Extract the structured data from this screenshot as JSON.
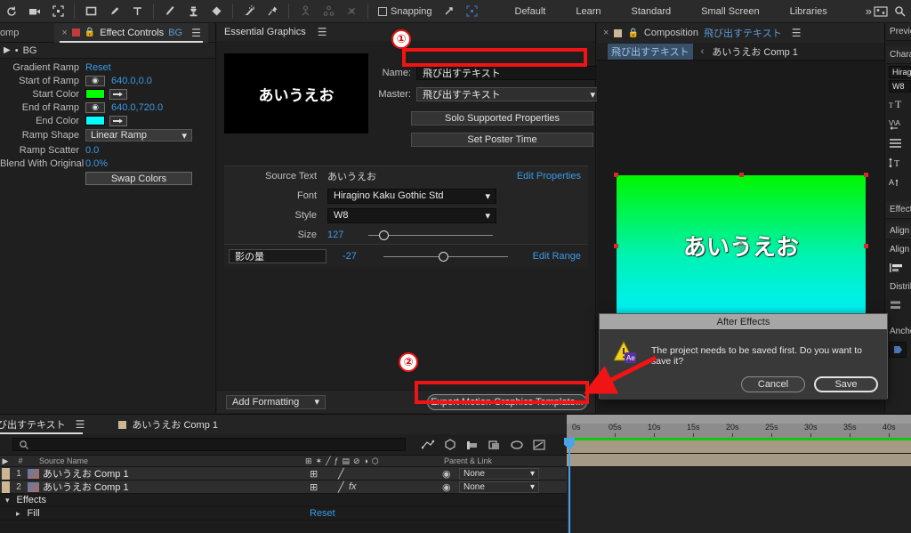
{
  "toolbar": {
    "tools": [
      {
        "name": "home-icon",
        "glyph": "↺"
      },
      {
        "name": "camera-icon",
        "glyph": "▶"
      },
      {
        "name": "region-of-interest-icon",
        "glyph": "⬚"
      },
      {
        "name": "shape-tool-icon",
        "glyph": "□"
      },
      {
        "name": "pen-tool-icon",
        "glyph": "✎"
      },
      {
        "name": "type-tool-icon",
        "glyph": "T"
      },
      {
        "name": "brush-tool-icon",
        "glyph": "╱"
      },
      {
        "name": "clone-stamp-icon",
        "glyph": "⚓"
      },
      {
        "name": "eraser-tool-icon",
        "glyph": "◆"
      },
      {
        "name": "roto-brush-icon",
        "glyph": "✐"
      },
      {
        "name": "puppet-pin-icon",
        "glyph": "✒"
      }
    ],
    "dim_tools": [
      {
        "name": "puppet-position-icon",
        "glyph": "♒"
      },
      {
        "name": "puppet-starch-icon",
        "glyph": "♔"
      },
      {
        "name": "puppet-overlap-icon",
        "glyph": "⚷"
      }
    ],
    "snapping_label": "Snapping",
    "align_icons": [
      {
        "name": "align-tool-icon",
        "glyph": "↗"
      },
      {
        "name": "grid-tool-icon",
        "glyph": "⬚"
      }
    ],
    "workspaces": [
      "Default",
      "Learn",
      "Standard",
      "Small Screen",
      "Libraries"
    ],
    "overflow_label": "»",
    "right_icons": [
      {
        "name": "workspace-settings-icon",
        "glyph": "▤"
      },
      {
        "name": "search-help-icon",
        "glyph": "⌕"
      }
    ]
  },
  "effect_controls": {
    "tabs": [
      {
        "label": "Comp",
        "active": false
      },
      {
        "label": "Effect Controls",
        "suffix": "BG",
        "active": true
      }
    ],
    "layer_header": "BG",
    "effect_name": "Gradient Ramp",
    "reset_label": "Reset",
    "rows": [
      {
        "label": "Start of Ramp",
        "value": "640.0,0.0",
        "type": "point"
      },
      {
        "label": "Start Color",
        "value": "#00ff00",
        "type": "color"
      },
      {
        "label": "End of Ramp",
        "value": "640.0,720.0",
        "type": "point"
      },
      {
        "label": "End Color",
        "value": "#00ffff",
        "type": "color"
      },
      {
        "label": "Ramp Shape",
        "value": "Linear Ramp",
        "type": "select"
      },
      {
        "label": "Ramp Scatter",
        "value": "0.0",
        "type": "number"
      },
      {
        "label": "Blend With Original",
        "value": "0.0%",
        "type": "number"
      }
    ],
    "swap_colors_label": "Swap Colors"
  },
  "essential_graphics": {
    "title": "Essential Graphics",
    "thumbnail_text": "あいうえお",
    "name_label": "Name:",
    "name_value": "飛び出すテキスト",
    "master_label": "Master:",
    "master_value": "飛び出すテキスト",
    "solo_button": "Solo Supported Properties",
    "poster_button": "Set Poster Time",
    "properties": [
      {
        "label": "Source Text",
        "value": "あいうえお",
        "action": "Edit Properties"
      },
      {
        "label": "Font",
        "value": "Hiragino Kaku Gothic Std",
        "type": "dropdown"
      },
      {
        "label": "Style",
        "value": "W8",
        "type": "dropdown"
      },
      {
        "label": "Size",
        "value": "127",
        "type": "slider",
        "slider_pct": 12
      }
    ],
    "range_row": {
      "name": "影の量",
      "value": "-27",
      "action": "Edit Range",
      "slider_pct": 48
    },
    "add_formatting_label": "Add Formatting",
    "export_button": "Export Motion Graphics Template..."
  },
  "composition": {
    "tab_prefix": "Composition",
    "tab_name": "飛び出すテキスト",
    "breadcrumb_current": "飛び出すテキスト",
    "breadcrumb_separator": "‹",
    "breadcrumb_next": "あいうえお Comp 1",
    "canvas_text": "あいうえお",
    "gradient_top": "#00f600",
    "gradient_bottom": "#00f0f8",
    "handle_color": "#d52b2b"
  },
  "right_strip": {
    "items": [
      {
        "type": "tab",
        "label": "Preview"
      },
      {
        "type": "tab",
        "label": "Character"
      },
      {
        "type": "field",
        "label": "Hiragino"
      },
      {
        "type": "field",
        "label": "W8"
      },
      {
        "type": "icon",
        "name": "font-size-icon",
        "glyph": "T"
      },
      {
        "type": "icon",
        "name": "kerning-icon",
        "glyph": "VA"
      },
      {
        "type": "icon",
        "name": "paragraph-icon",
        "glyph": "☰"
      },
      {
        "type": "icon",
        "name": "leading-icon",
        "glyph": "T"
      },
      {
        "type": "icon",
        "name": "tracking-icon",
        "glyph": "A"
      },
      {
        "type": "tab",
        "label": "Effects"
      },
      {
        "type": "tab",
        "label": "Align"
      },
      {
        "type": "label",
        "label": "Align Layers to:"
      },
      {
        "type": "icon",
        "name": "align-left-icon",
        "glyph": "❙"
      },
      {
        "type": "label",
        "label": "Distribute Layers:"
      },
      {
        "type": "icon",
        "name": "distribute-icon",
        "glyph": "≡"
      },
      {
        "type": "label",
        "label": "Anchor Point"
      }
    ]
  },
  "dialog": {
    "title": "After Effects",
    "message": "The project needs to be saved first. Do you want to save it?",
    "cancel_label": "Cancel",
    "save_label": "Save",
    "app_badge": "Ae"
  },
  "timeline": {
    "tabs": [
      {
        "label": "飛び出すテキスト",
        "active": true
      },
      {
        "label": "あいうえお Comp 1",
        "active": false
      }
    ],
    "search_placeholder": "",
    "toolbar_icons": [
      {
        "name": "graph-editor-icon",
        "glyph": "⎇"
      },
      {
        "name": "3d-renderer-icon",
        "glyph": "⬢"
      },
      {
        "name": "motion-blur-icon",
        "glyph": "☸"
      },
      {
        "name": "frame-blend-icon",
        "glyph": "❐"
      },
      {
        "name": "shy-layers-icon",
        "glyph": "◍"
      },
      {
        "name": "graph-icon",
        "glyph": "↗"
      }
    ],
    "columns": [
      "#",
      "Source Name",
      "Parent & Link"
    ],
    "switch_icons": [
      "⊞",
      "✶",
      "╱",
      "fx",
      "▤",
      "⊘",
      "◑",
      "⬡"
    ],
    "layers": [
      {
        "num": "1",
        "name": "あいうえお Comp 1",
        "parent": "None",
        "has_fx": false
      },
      {
        "num": "2",
        "name": "あいうえお Comp 1",
        "parent": "None",
        "has_fx": true
      }
    ],
    "effects_group": "Effects",
    "effect_item": "Fill",
    "effect_reset": "Reset",
    "ruler_labels": [
      "0s",
      "05s",
      "10s",
      "15s",
      "20s",
      "25s",
      "30s",
      "35s",
      "40s"
    ]
  },
  "annotations": {
    "marker_one": "①",
    "marker_two": "②",
    "color": "#f01414"
  }
}
